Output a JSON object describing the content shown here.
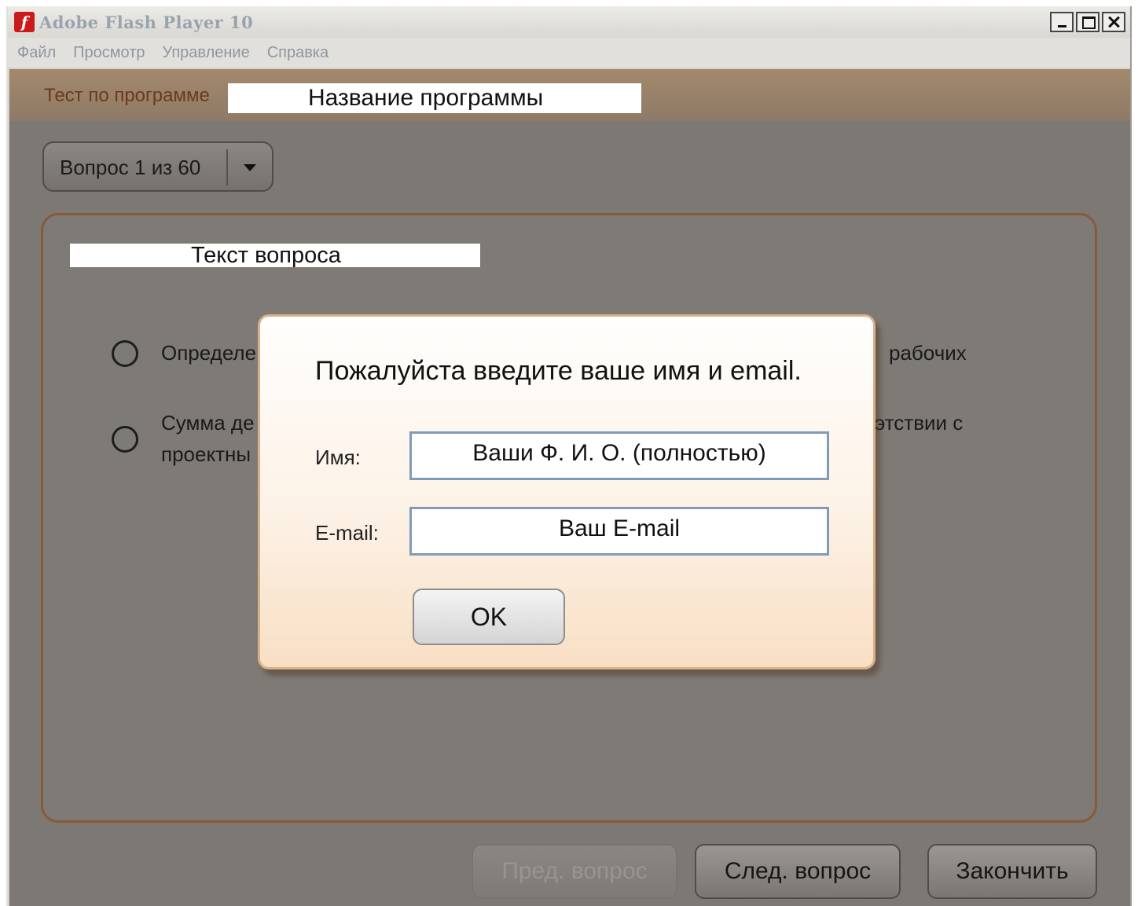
{
  "window": {
    "title": "Adobe Flash Player 10",
    "controls": [
      "minimize",
      "maximize",
      "close"
    ]
  },
  "menu": {
    "items": [
      "Файл",
      "Просмотр",
      "Управление",
      "Справка"
    ]
  },
  "header": {
    "label": "Тест по программе",
    "program_name": "Название программы"
  },
  "question_selector": {
    "label": "Вопрос 1 из 60"
  },
  "question": {
    "text": "Текст вопроса",
    "answers": [
      {
        "left": "Определе",
        "right": "рабочих"
      },
      {
        "left_line1": "Сумма де",
        "left_line2": "проектны",
        "right": "этствии с"
      }
    ]
  },
  "navigation": {
    "prev": "Пред. вопрос",
    "next": "След. вопрос",
    "finish": "Закончить"
  },
  "dialog": {
    "title": "Пожалуйста введите ваше имя и email.",
    "name_label": "Имя:",
    "name_value": "Ваши Ф. И. О. (полностью)",
    "email_label": "E-mail:",
    "email_value": "Ваш E-mail",
    "ok": "OK"
  },
  "colors": {
    "stage_bg": "#7c7874",
    "panel_border": "#8a5a36",
    "header_label": "#6b3a1a",
    "flash_icon": "#cc1a1a"
  }
}
